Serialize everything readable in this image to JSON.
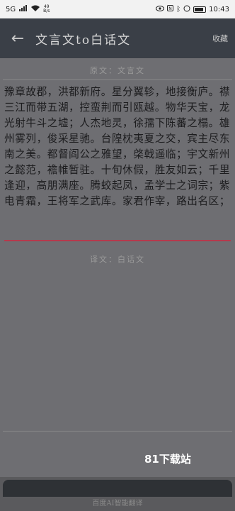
{
  "status_bar": {
    "carrier": "5G",
    "speed_value": "49",
    "speed_unit": "B/s",
    "time": "10:43",
    "icons": [
      "signal-icon",
      "wifi-icon",
      "nfc-icon",
      "bluetooth-icon",
      "battery-icon"
    ]
  },
  "app_bar": {
    "title": "文言文to白话文",
    "favorite_label": "收藏"
  },
  "source_section": {
    "label": "原文：文言文",
    "text": "豫章故郡，洪都新府。星分翼轸，地接衡庐。襟三江而带五湖，控蛮荆而引瓯越。物华天宝，龙光射牛斗之墟；人杰地灵，徐孺下陈蕃之榻。雄州雾列，俊采星驰。台隍枕夷夏之交，宾主尽东南之美。都督阎公之雅望，棨戟遥临；宇文新州之懿范，襜帷暂驻。十旬休假，胜友如云；千里逢迎，高朋满座。腾蛟起凤，孟学士之词宗；紫电青霜，王将军之武库。家君作宰，路出名区；"
  },
  "translation_section": {
    "label": "译文：白话文",
    "text": ""
  },
  "watermark": "81下载站",
  "footer": {
    "caption": "百度AI智能翻译"
  },
  "colors": {
    "app_bar": "#3a3f47",
    "content_bg": "#6e6e72",
    "underline_accent": "#b5394c"
  }
}
